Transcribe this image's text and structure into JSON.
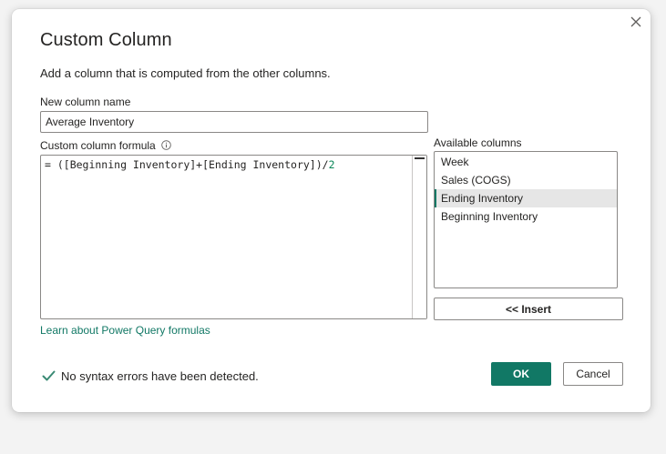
{
  "dialog": {
    "title": "Custom Column",
    "subtitle": "Add a column that is computed from the other columns."
  },
  "name_field": {
    "label": "New column name",
    "value": "Average Inventory"
  },
  "formula": {
    "label": "Custom column formula",
    "prefix": "= ([Beginning Inventory]+[Ending Inventory])/",
    "divisor": "2"
  },
  "columns": {
    "label": "Available columns",
    "items": [
      {
        "label": "Week"
      },
      {
        "label": "Sales (COGS)"
      },
      {
        "label": "Ending Inventory"
      },
      {
        "label": "Beginning Inventory"
      }
    ],
    "selected_index": 2
  },
  "insert_label": "<< Insert",
  "learn_link": "Learn about Power Query formulas",
  "status": {
    "text": "No syntax errors have been detected."
  },
  "buttons": {
    "ok": "OK",
    "cancel": "Cancel"
  },
  "colors": {
    "accent": "#117865",
    "success": "#3a8a74",
    "number": "#098658"
  },
  "icons": {
    "close": "close-icon",
    "info": "info-icon",
    "check": "checkmark-icon"
  }
}
